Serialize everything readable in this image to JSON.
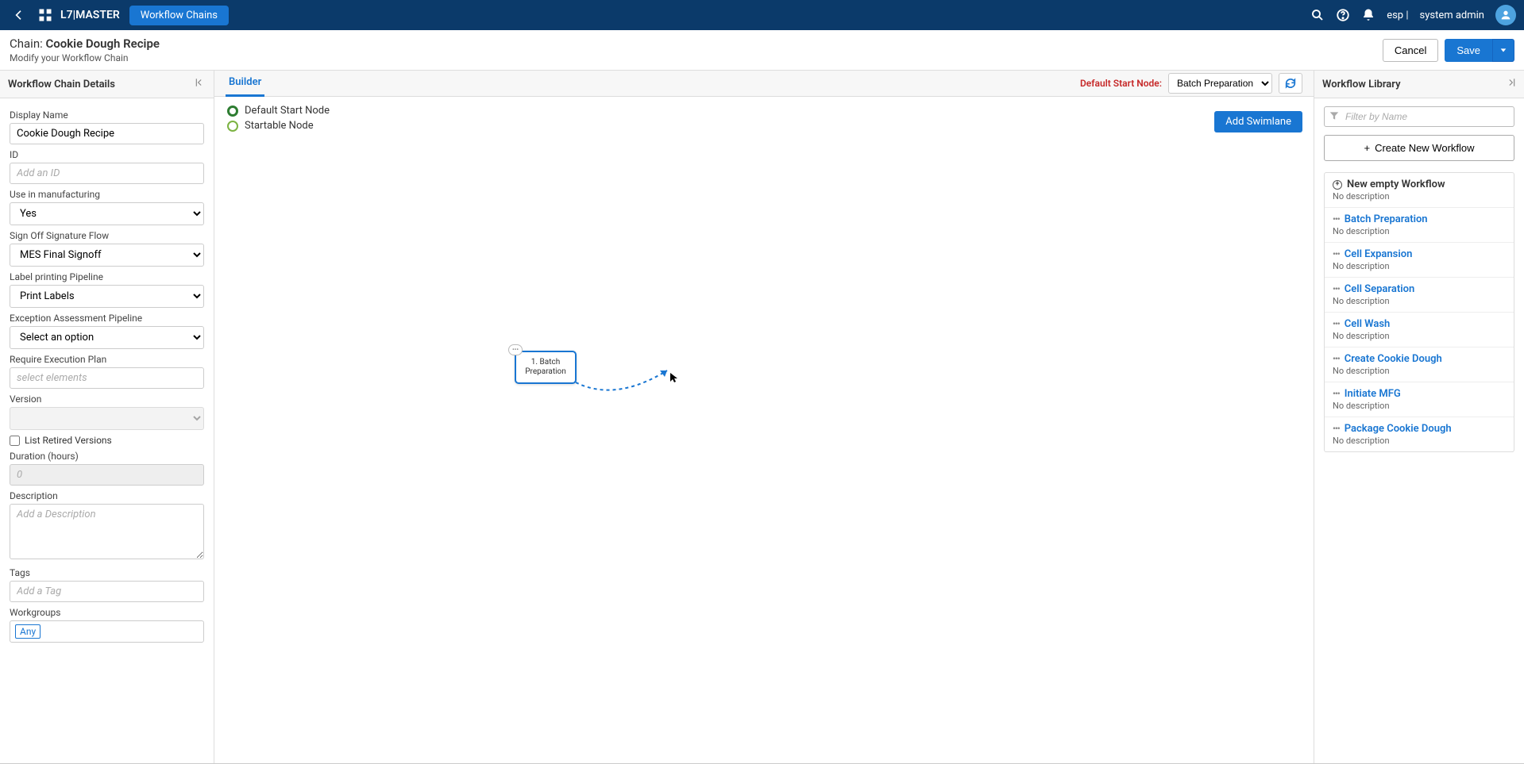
{
  "topbar": {
    "brand": "L7|MASTER",
    "chip": "Workflow Chains",
    "esp": "esp",
    "user": "system admin"
  },
  "subheader": {
    "crumb_label": "Chain: ",
    "crumb_value": "Cookie Dough Recipe",
    "subtitle": "Modify your Workflow Chain",
    "cancel": "Cancel",
    "save": "Save"
  },
  "left": {
    "title": "Workflow Chain Details",
    "display_name_label": "Display Name",
    "display_name_value": "Cookie Dough Recipe",
    "id_label": "ID",
    "id_placeholder": "Add an ID",
    "use_mfg_label": "Use in manufacturing",
    "use_mfg_value": "Yes",
    "signoff_label": "Sign Off Signature Flow",
    "signoff_value": "MES Final Signoff",
    "labelpipe_label": "Label printing Pipeline",
    "labelpipe_value": "Print Labels",
    "exception_label": "Exception Assessment Pipeline",
    "exception_value": "Select an option",
    "execplan_label": "Require Execution Plan",
    "execplan_placeholder": "select elements",
    "version_label": "Version",
    "retired_label": "List Retired Versions",
    "duration_label": "Duration (hours)",
    "duration_placeholder": "0",
    "desc_label": "Description",
    "desc_placeholder": "Add a Description",
    "tags_label": "Tags",
    "tags_placeholder": "Add a Tag",
    "workgroups_label": "Workgroups",
    "workgroups_any": "Any"
  },
  "center": {
    "tab": "Builder",
    "legend_default": "Default Start Node",
    "legend_startable": "Startable Node",
    "default_start_label": "Default Start Node:",
    "default_start_value": "Batch Preparation",
    "add_swimlane": "Add Swimlane",
    "node_title": "1. Batch Preparation"
  },
  "right": {
    "title": "Workflow Library",
    "filter_placeholder": "Filter by Name",
    "create_btn": "Create New Workflow",
    "new_empty": "New empty Workflow",
    "no_desc": "No description",
    "items": [
      {
        "name": "Batch Preparation"
      },
      {
        "name": "Cell Expansion"
      },
      {
        "name": "Cell Separation"
      },
      {
        "name": "Cell Wash"
      },
      {
        "name": "Create Cookie Dough"
      },
      {
        "name": "Initiate MFG"
      },
      {
        "name": "Package Cookie Dough"
      }
    ]
  }
}
